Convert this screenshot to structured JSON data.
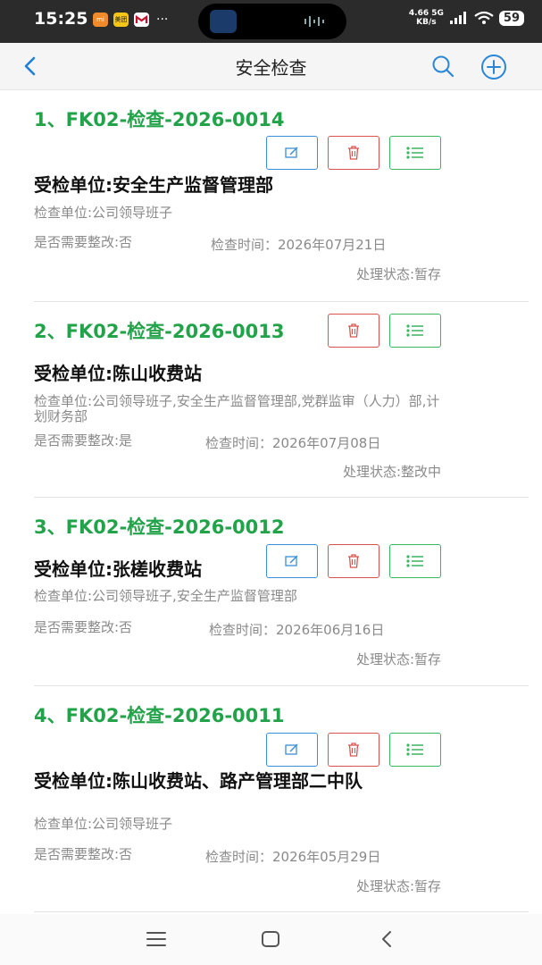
{
  "status_bar": {
    "time": "15:25",
    "app_icons": [
      "mi-icon",
      "meituan-icon",
      "bank-icon"
    ],
    "app_labels": [
      "mi",
      "美团",
      ""
    ],
    "more": "···",
    "net_speed_top": "4.66 5G",
    "net_speed_bottom": "KB/s",
    "battery": "59"
  },
  "header": {
    "title": "安全检查",
    "icons": [
      "chevron-left-icon",
      "search-icon",
      "add-circle-icon"
    ]
  },
  "records": [
    {
      "title": "1、FK02-检查-2026-0014",
      "unit": "受检单位:安全生产监督管理部",
      "inspector": "检查单位:公司领导班子",
      "rectify": "是否需要整改:否",
      "time": "检查时间：2026年07月21日",
      "status": "处理状态:暂存",
      "buttons": [
        "edit",
        "delete",
        "list"
      ]
    },
    {
      "title": "2、FK02-检查-2026-0013",
      "unit": "受检单位:陈山收费站",
      "inspector": "检查单位:公司领导班子,安全生产监督管理部,党群监审（人力）部,计划财务部",
      "rectify": "是否需要整改:是",
      "time": "检查时间：2026年07月08日",
      "status": "处理状态:整改中",
      "buttons": [
        "delete",
        "list"
      ]
    },
    {
      "title": "3、FK02-检查-2026-0012",
      "unit": "受检单位:张槎收费站",
      "inspector": "检查单位:公司领导班子,安全生产监督管理部",
      "rectify": "是否需要整改:否",
      "time": "检查时间：2026年06月16日",
      "status": "处理状态:暂存",
      "buttons": [
        "edit",
        "delete",
        "list"
      ]
    },
    {
      "title": "4、FK02-检查-2026-0011",
      "unit": "受检单位:陈山收费站、路产管理部二中队",
      "inspector": "检查单位:公司领导班子",
      "rectify": "是否需要整改:否",
      "time": "检查时间：2026年05月29日",
      "status": "处理状态:暂存",
      "buttons": [
        "edit",
        "delete",
        "list"
      ]
    }
  ],
  "colors": {
    "title_green": "#22a34a",
    "edit_blue": "#3a8fd8",
    "delete_red": "#d9534f",
    "list_green": "#3bb463"
  },
  "nav_bar": {
    "icons": [
      "menu-icon",
      "home-icon",
      "back-icon"
    ]
  }
}
